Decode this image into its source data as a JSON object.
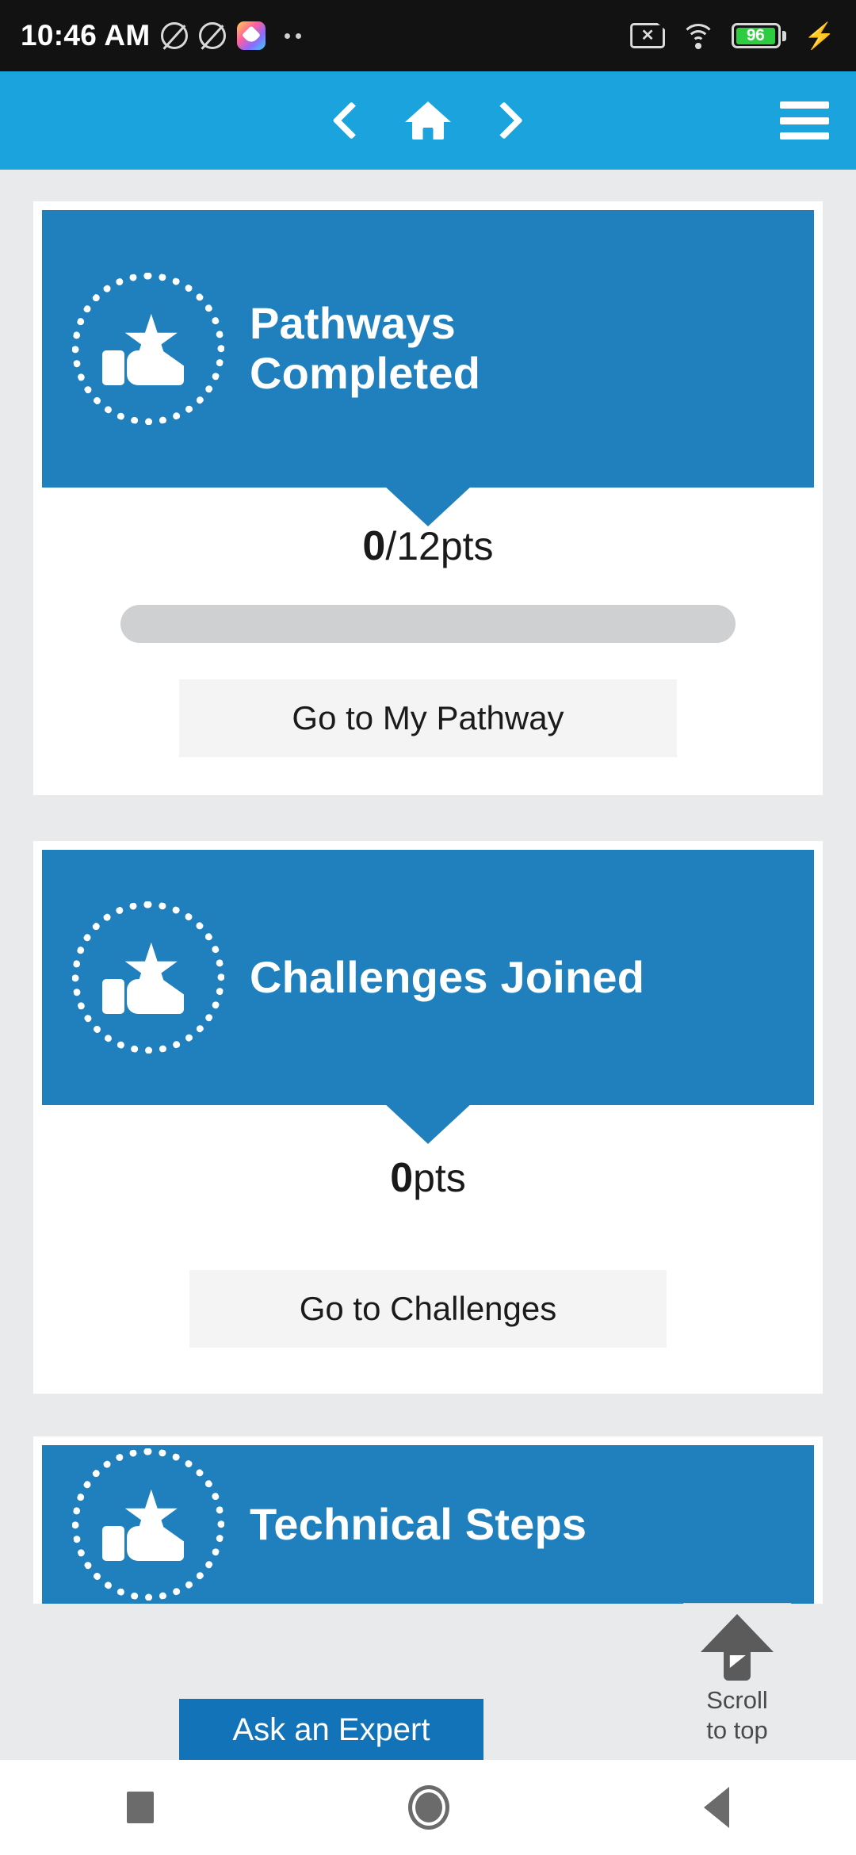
{
  "status_bar": {
    "time": "10:46 AM",
    "icons": [
      "no-sound-icon",
      "no-sound-icon",
      "gallery-app-icon",
      "more-dots-icon"
    ],
    "sim_label": "✕",
    "battery_percent": "96",
    "battery_level": 96,
    "charging": true,
    "right_icons": [
      "sim-card-disabled-icon",
      "wifi-icon",
      "battery-icon",
      "charging-bolt-icon"
    ]
  },
  "appbar": {
    "back_icon": "chevron-left-icon",
    "home_icon": "home-icon",
    "forward_icon": "chevron-right-icon",
    "menu_icon": "hamburger-menu-icon",
    "background_color": "#1aa3dd"
  },
  "theme": {
    "page_background": "#e9eaec",
    "card_blue": "#1f80bd",
    "topbar_blue": "#1aa3dd",
    "button_gray": "#f4f4f4",
    "progress_track": "#cfd0d2",
    "text_dark": "#1a1a1a"
  },
  "cards": [
    {
      "id": "pathways-completed",
      "badge_icon": "star-hand-badge-icon",
      "title": "Pathways\nCompleted",
      "title_line_1": "Pathways",
      "title_line_2": "Completed",
      "points_value": "0",
      "points_suffix": "/12pts",
      "points_total": 12,
      "points_earned": 0,
      "progress_percent": 0,
      "has_progress_bar": true,
      "button_label": "Go to My Pathway"
    },
    {
      "id": "challenges-joined",
      "badge_icon": "star-hand-badge-icon",
      "title": "Challenges Joined",
      "title_line_1": "Challenges Joined",
      "title_line_2": "",
      "points_value": "0",
      "points_suffix": "pts",
      "points_earned": 0,
      "progress_percent": 0,
      "has_progress_bar": false,
      "button_label": "Go to Challenges"
    },
    {
      "id": "technical-steps",
      "badge_icon": "star-hand-badge-icon",
      "title": "Technical Steps",
      "title_line_1": "Technical Steps",
      "title_line_2": "",
      "points_value": "",
      "points_suffix": "",
      "has_progress_bar": false,
      "button_label": ""
    }
  ],
  "floating": {
    "ask_expert_label": "Ask an Expert",
    "scroll_top_icon": "arrow-up-icon",
    "scroll_top_line_1": "Scroll",
    "scroll_top_line_2": "to top"
  },
  "android_nav": {
    "recents_icon": "square-recents-icon",
    "home_icon": "circle-home-icon",
    "back_icon": "triangle-back-icon"
  }
}
